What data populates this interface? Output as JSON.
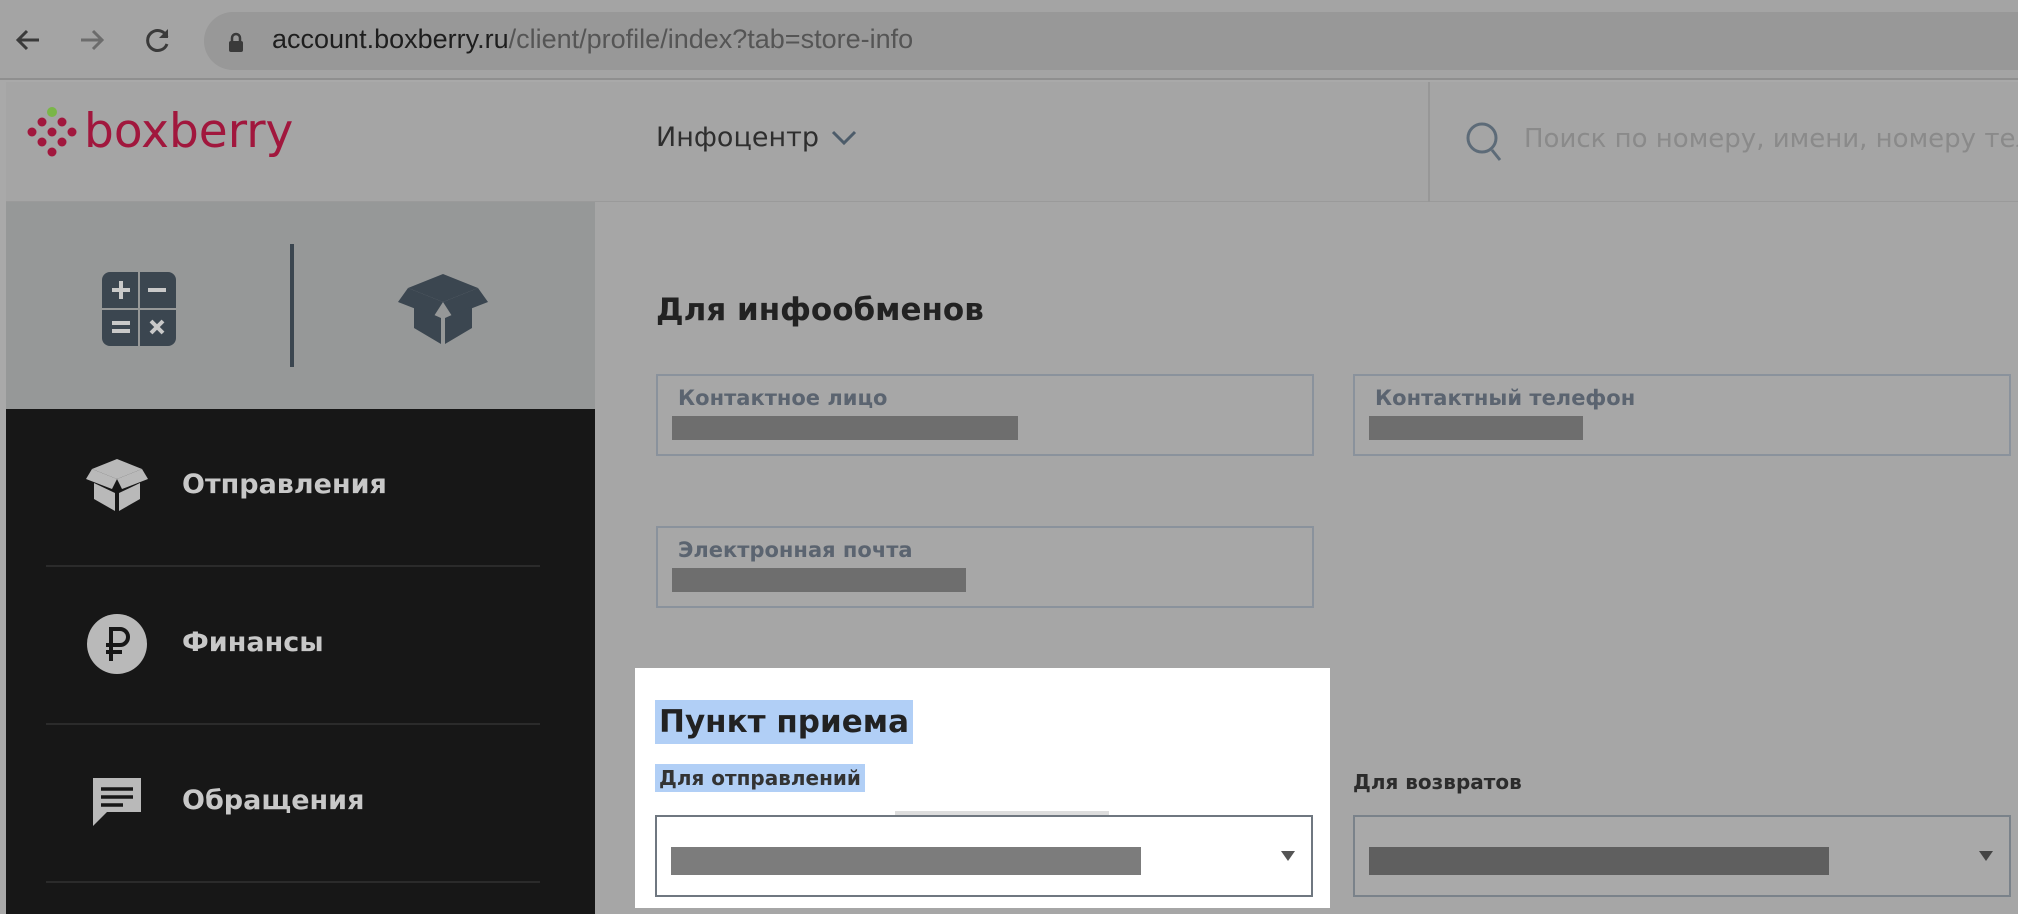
{
  "browser": {
    "url_domain": "account.boxberry.ru",
    "url_path": "/client/profile/index?tab=store-info"
  },
  "header": {
    "logo_text": "boxberry",
    "menu_label": "Инфоцентр",
    "search_placeholder": "Поиск по номеру, имени, номеру теле"
  },
  "sidebar": {
    "items": [
      {
        "label": "Отправления",
        "icon": "parcels-icon"
      },
      {
        "label": "Финансы",
        "icon": "ruble-icon"
      },
      {
        "label": "Обращения",
        "icon": "chat-icon"
      }
    ]
  },
  "info_section": {
    "title": "Для инфообменов",
    "contact_person_label": "Контактное лицо",
    "contact_phone_label": "Контактный телефон",
    "email_label": "Электронная почта"
  },
  "pickup_section": {
    "title": "Пункт приема",
    "for_shipments_label": "Для отправлений",
    "for_returns_label": "Для возвратов"
  },
  "colors": {
    "brand": "#a1173d",
    "selection": "#b1cff6",
    "sidebar_bg": "#171717"
  }
}
